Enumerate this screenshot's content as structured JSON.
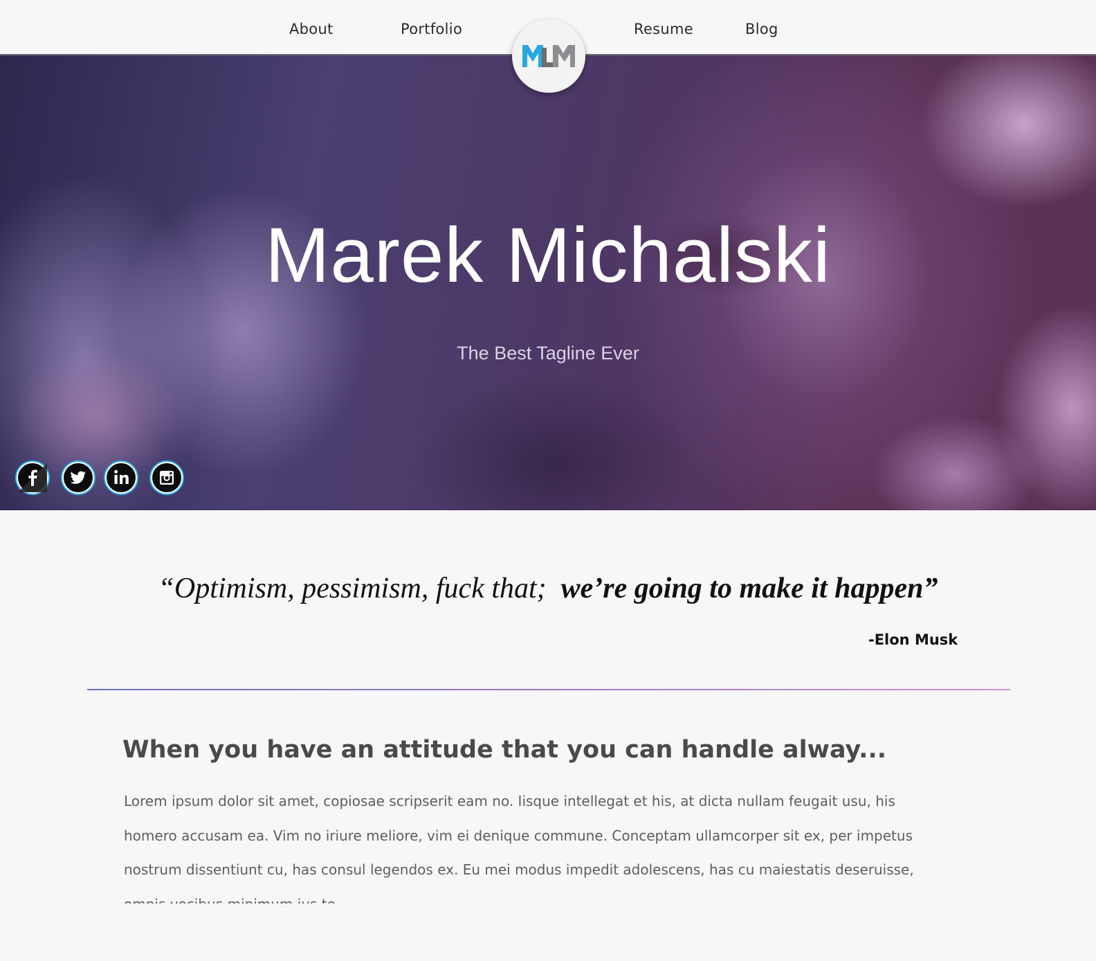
{
  "nav": {
    "items": [
      {
        "label": "About"
      },
      {
        "label": "Portfolio"
      },
      {
        "label": "Resume"
      },
      {
        "label": "Blog"
      }
    ],
    "logo_text": "MLM"
  },
  "hero": {
    "title": "Marek Michalski",
    "tagline": "The Best Tagline Ever"
  },
  "social": {
    "icons": [
      "facebook-icon",
      "twitter-icon",
      "linkedin-icon",
      "instagram-icon"
    ]
  },
  "quote": {
    "part1": "“Optimism, pessimism, fuck that;",
    "part2": "we’re going to make it happen”",
    "author": "-Elon Musk"
  },
  "post": {
    "title": "When you have an attitude that you can handle alway...",
    "body": "Lorem ipsum dolor sit amet, copiosae scripserit eam no. Iisque intellegat et his, at dicta nullam feugait usu, his homero accusam ea. Vim no iriure meliore, vim ei denique commune. Conceptam ullamcorper sit ex, per impetus nostrum dissentiunt cu, has consul legendos ex. Eu mei modus impedit adolescens, has cu maiestatis deseruisse, omnis vocibus minimum ius te."
  },
  "colors": {
    "logo_blue": "#27a8e0",
    "logo_gray": "#8e8e92",
    "hero_overlay": "#4d3765",
    "social_ring": "#2fb6ea",
    "divider_start": "#6b6fc4",
    "divider_end": "#c894da"
  }
}
